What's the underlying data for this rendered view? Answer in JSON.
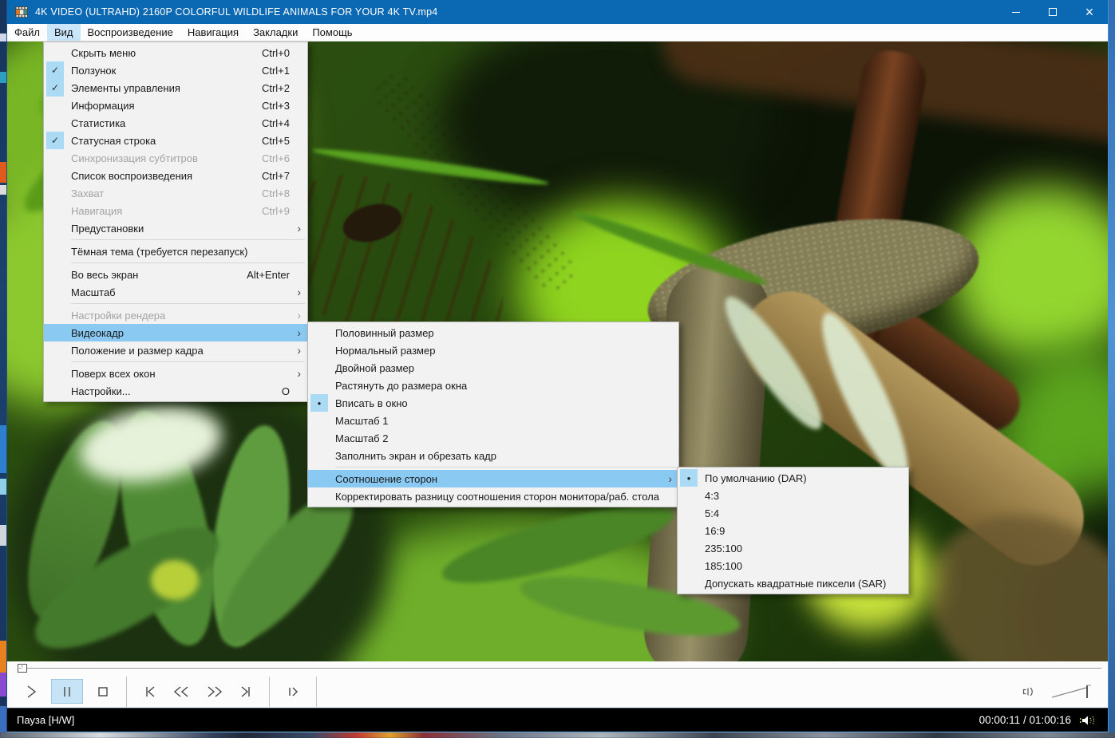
{
  "titlebar": {
    "title": "4K VIDEO (ULTRAHD) 2160P COLORFUL WILDLIFE ANIMALS FOR YOUR 4K TV.mp4"
  },
  "icons": {
    "check": "✓",
    "radio": "●",
    "submenu_arrow": "›",
    "minimize": "–",
    "maximize": "□",
    "close": "×"
  },
  "menubar": {
    "items": [
      {
        "label": "Файл"
      },
      {
        "label": "Вид",
        "active": true
      },
      {
        "label": "Воспроизведение"
      },
      {
        "label": "Навигация"
      },
      {
        "label": "Закладки"
      },
      {
        "label": "Помощь"
      }
    ]
  },
  "view_menu": {
    "items": [
      {
        "label": "Скрыть меню",
        "shortcut": "Ctrl+0"
      },
      {
        "label": "Ползунок",
        "shortcut": "Ctrl+1",
        "checked": true
      },
      {
        "label": "Элементы управления",
        "shortcut": "Ctrl+2",
        "checked": true
      },
      {
        "label": "Информация",
        "shortcut": "Ctrl+3"
      },
      {
        "label": "Статистика",
        "shortcut": "Ctrl+4"
      },
      {
        "label": "Статусная строка",
        "shortcut": "Ctrl+5",
        "checked": true
      },
      {
        "label": "Синхронизация субтитров",
        "shortcut": "Ctrl+6",
        "disabled": true
      },
      {
        "label": "Список воспроизведения",
        "shortcut": "Ctrl+7"
      },
      {
        "label": "Захват",
        "shortcut": "Ctrl+8",
        "disabled": true
      },
      {
        "label": "Навигация",
        "shortcut": "Ctrl+9",
        "disabled": true
      },
      {
        "label": "Предустановки",
        "submenu": true
      },
      {
        "label": "Тёмная тема (требуется перезапуск)"
      },
      {
        "label": "Во весь экран",
        "shortcut": "Alt+Enter"
      },
      {
        "label": "Масштаб",
        "submenu": true
      },
      {
        "label": "Настройки рендера",
        "submenu": true,
        "disabled": true
      },
      {
        "label": "Видеокадр",
        "submenu": true,
        "highlighted": true
      },
      {
        "label": "Положение и размер кадра",
        "submenu": true
      },
      {
        "label": "Поверх всех окон",
        "submenu": true
      },
      {
        "label": "Настройки...",
        "shortcut": "O"
      }
    ]
  },
  "frame_submenu": {
    "items": [
      {
        "label": "Половинный размер"
      },
      {
        "label": "Нормальный размер"
      },
      {
        "label": "Двойной размер"
      },
      {
        "label": "Растянуть до размера окна"
      },
      {
        "label": "Вписать в окно",
        "selected": true
      },
      {
        "label": "Масштаб 1"
      },
      {
        "label": "Масштаб 2"
      },
      {
        "label": "Заполнить экран и обрезать кадр"
      },
      {
        "label": "Соотношение сторон",
        "submenu": true,
        "highlighted": true
      },
      {
        "label": "Корректировать разницу соотношения сторон монитора/раб. стола"
      }
    ]
  },
  "aspect_submenu": {
    "items": [
      {
        "label": "По умолчанию (DAR)",
        "selected": true
      },
      {
        "label": "4:3"
      },
      {
        "label": "5:4"
      },
      {
        "label": "16:9"
      },
      {
        "label": "235:100"
      },
      {
        "label": "185:100"
      },
      {
        "label": "Допускать квадратные пиксели (SAR)"
      }
    ]
  },
  "transport": {
    "buttons": [
      {
        "name": "play"
      },
      {
        "name": "pause",
        "active": true
      },
      {
        "name": "stop"
      },
      {
        "name": "skip-to-start"
      },
      {
        "name": "rewind"
      },
      {
        "name": "fast-forward"
      },
      {
        "name": "skip-to-end"
      },
      {
        "name": "frame-step"
      },
      {
        "name": "volume"
      }
    ]
  },
  "statusbar": {
    "state": "Пауза [H/W]",
    "time": "00:00:11 / 01:00:16"
  },
  "colors": {
    "titlebar": "#0b68b2",
    "menu_highlight": "#89c9f2",
    "gutter_highlight": "#abdaf5",
    "menubar_active": "#c9e6fa",
    "statusbar_bg": "#000000",
    "pause_active_bg": "#c7e3f6"
  }
}
